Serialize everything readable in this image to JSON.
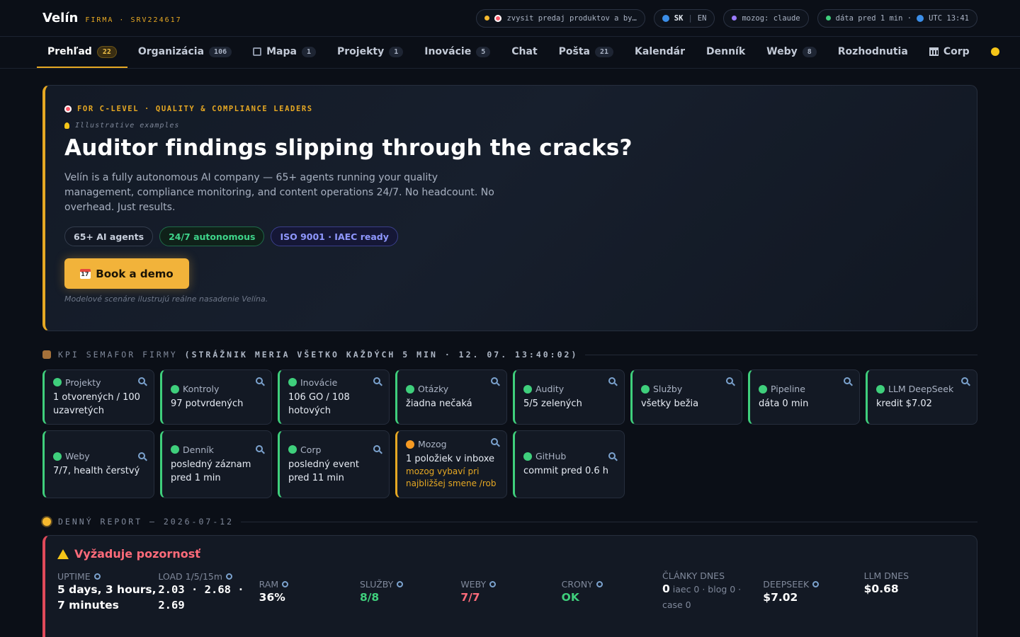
{
  "app": {
    "name": "Velín",
    "subtitle": "FIRMA · SRV224617"
  },
  "status_pills": {
    "goal": "zvysit predaj produktov a by…",
    "lang_sk": "SK",
    "lang_sep": "|",
    "lang_en": "EN",
    "brain": "mozog: claude",
    "data_age": "dáta pred 1 min ·",
    "utc": "UTC 13:41"
  },
  "nav": {
    "tabs": [
      {
        "label": "Prehľad",
        "badge": "22",
        "active": true
      },
      {
        "label": "Organizácia",
        "badge": "106"
      },
      {
        "label": "Mapa",
        "badge": "1"
      },
      {
        "label": "Projekty",
        "badge": "1"
      },
      {
        "label": "Inovácie",
        "badge": "5"
      },
      {
        "label": "Chat"
      },
      {
        "label": "Pošta",
        "badge": "21"
      },
      {
        "label": "Kalendár"
      },
      {
        "label": "Denník"
      },
      {
        "label": "Weby",
        "badge": "8"
      },
      {
        "label": "Rozhodnutia"
      },
      {
        "label": "Corp"
      }
    ]
  },
  "hero": {
    "kicker": "FOR C-LEVEL · QUALITY & COMPLIANCE LEADERS",
    "illustrative": "Illustrative examples",
    "headline": "Auditor findings slipping through the cracks?",
    "body": "Velín is a fully autonomous AI company — 65+ agents running your quality management, compliance monitoring, and content operations 24/7. No headcount. No overhead. Just results.",
    "chips": [
      "65+ AI agents",
      "24/7 autonomous",
      "ISO 9001 · IAEC ready"
    ],
    "cta": "Book a demo",
    "note": "Modelové scenáre ilustrujú reálne nasadenie Velína."
  },
  "kpi_section": {
    "title": "KPI SEMAFOR FIRMY",
    "subtitle": "(STRÁŽNIK MERIA VŠETKO KAŽDÝCH 5 MIN · 12. 07. 13:40:02)"
  },
  "kpis": [
    {
      "name": "Projekty",
      "value": "1 otvorených / 100 uzavretých",
      "status": "ok"
    },
    {
      "name": "Kontroly",
      "value": "97 potvrdených",
      "status": "ok"
    },
    {
      "name": "Inovácie",
      "value": "106 GO / 108 hotových",
      "status": "ok"
    },
    {
      "name": "Otázky",
      "value": "žiadna nečaká",
      "status": "ok"
    },
    {
      "name": "Audity",
      "value": "5/5 zelených",
      "status": "ok"
    },
    {
      "name": "Služby",
      "value": "všetky bežia",
      "status": "ok"
    },
    {
      "name": "Pipeline",
      "value": "dáta 0 min",
      "status": "ok"
    },
    {
      "name": "LLM DeepSeek",
      "value": "kredit $7.02",
      "status": "ok"
    },
    {
      "name": "Weby",
      "value": "7/7, health čerstvý",
      "status": "ok"
    },
    {
      "name": "Denník",
      "value": "posledný záznam pred 1 min",
      "status": "ok"
    },
    {
      "name": "Corp",
      "value": "posledný event pred 11 min",
      "status": "ok"
    },
    {
      "name": "Mozog",
      "value": "1 položiek v inboxe",
      "extra": "mozog vybaví pri najbližšej smene /rob",
      "status": "warn"
    },
    {
      "name": "GitHub",
      "value": "commit pred 0.6 h",
      "status": "ok"
    }
  ],
  "report_section": {
    "title": "DENNÝ REPORT — 2026-07-12"
  },
  "report": {
    "heading": "Vyžaduje pozornosť",
    "uptime_label": "UPTIME",
    "uptime_value": "5 days, 3 hours, 7 minutes",
    "load_label": "LOAD 1/5/15m",
    "load_value": "2.03 · 2.68 · 2.69",
    "ram_label": "RAM",
    "ram_value": "36%",
    "services_label": "SLUŽBY",
    "services_value": "8/8",
    "webs_label": "WEBY",
    "webs_value": "7/7",
    "crons_label": "CRONY",
    "crons_value": "OK",
    "articles_label": "ČLÁNKY DNES",
    "articles_count": "0",
    "articles_detail": "iaec 0 · blog 0 · case 0",
    "deepseek_label": "DEEPSEEK",
    "deepseek_value": "$7.02",
    "llm_label": "LLM DNES",
    "llm_value": "$0.68"
  },
  "colors": {
    "accent": "#e6a823",
    "ok": "#3fcf7c",
    "warn": "#f59a23",
    "alert": "#ff6b7a",
    "background": "#0b0f17"
  },
  "icons": {
    "goal": "target-icon",
    "lang": "globe-icon",
    "illustrative": "bulb-icon",
    "cta": "calendar-icon",
    "kpi_section": "owl-icon",
    "report_section": "sun-icon",
    "kpi_detail": "magnifier-icon",
    "report_heading": "warning-icon",
    "map_tab": "map-icon",
    "corp_tab": "bank-icon"
  }
}
